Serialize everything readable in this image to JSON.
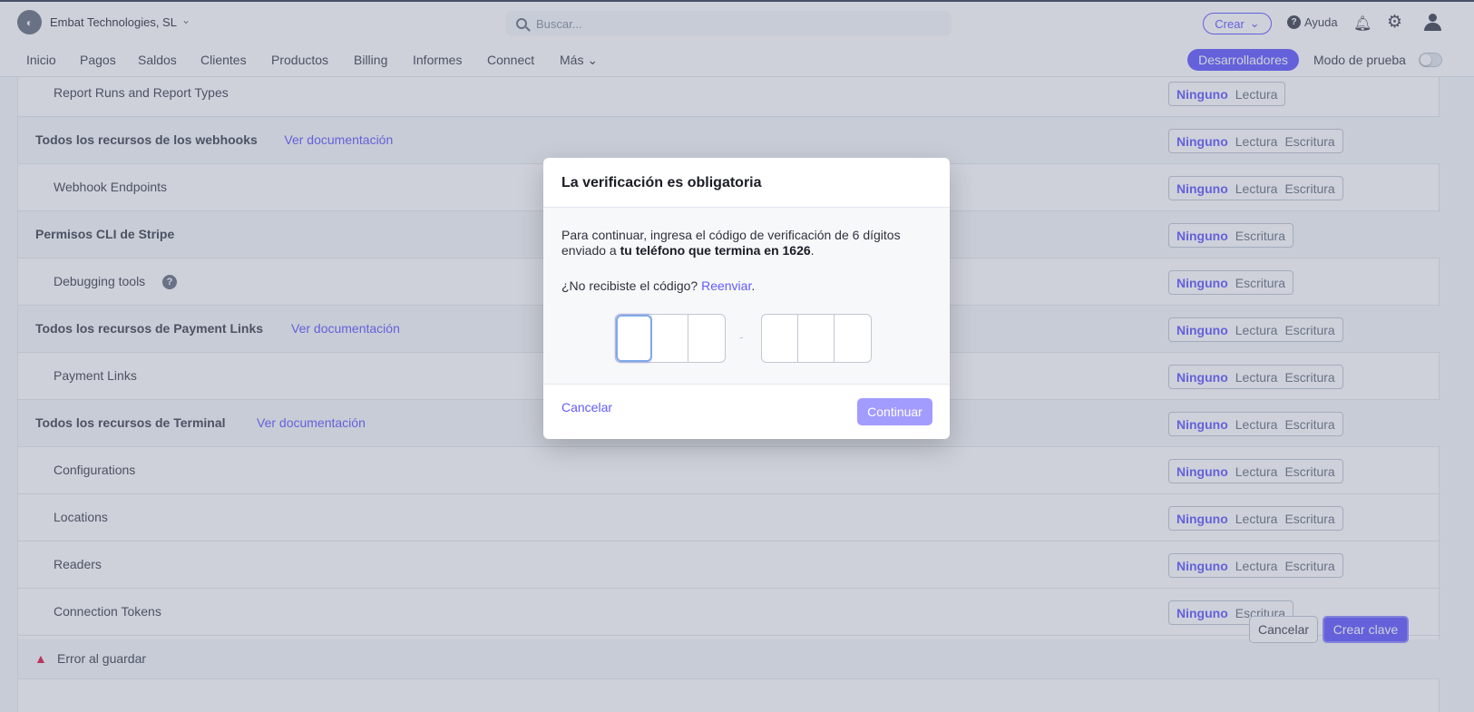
{
  "header": {
    "account_name": "Embat Technologies, SL",
    "search_placeholder": "Buscar...",
    "create_label": "Crear",
    "help_label": "Ayuda"
  },
  "nav": {
    "items": [
      "Inicio",
      "Pagos",
      "Saldos",
      "Clientes",
      "Productos",
      "Billing",
      "Informes",
      "Connect",
      "Más"
    ],
    "developers_label": "Desarrolladores",
    "test_mode_label": "Modo de prueba",
    "test_mode_on": false
  },
  "permissions": [
    {
      "label": "Report Runs and Report Types",
      "kind": "sub",
      "options": [
        "Ninguno",
        "Lectura"
      ],
      "selected": "Ninguno"
    },
    {
      "label": "Todos los recursos de los webhooks",
      "kind": "group",
      "doc_link": "Ver documentación",
      "options": [
        "Ninguno",
        "Lectura",
        "Escritura"
      ],
      "selected": "Ninguno"
    },
    {
      "label": "Webhook Endpoints",
      "kind": "sub",
      "options": [
        "Ninguno",
        "Lectura",
        "Escritura"
      ],
      "selected": "Ninguno"
    },
    {
      "label": "Permisos CLI de Stripe",
      "kind": "group",
      "options": [
        "Ninguno",
        "Escritura"
      ],
      "selected": "Ninguno"
    },
    {
      "label": "Debugging tools",
      "kind": "sub",
      "info": true,
      "options": [
        "Ninguno",
        "Escritura"
      ],
      "selected": "Ninguno"
    },
    {
      "label": "Todos los recursos de Payment Links",
      "kind": "group",
      "doc_link": "Ver documentación",
      "options": [
        "Ninguno",
        "Lectura",
        "Escritura"
      ],
      "selected": "Ninguno"
    },
    {
      "label": "Payment Links",
      "kind": "sub",
      "options": [
        "Ninguno",
        "Lectura",
        "Escritura"
      ],
      "selected": "Ninguno"
    },
    {
      "label": "Todos los recursos de Terminal",
      "kind": "group",
      "doc_link": "Ver documentación",
      "options": [
        "Ninguno",
        "Lectura",
        "Escritura"
      ],
      "selected": "Ninguno"
    },
    {
      "label": "Configurations",
      "kind": "sub",
      "options": [
        "Ninguno",
        "Lectura",
        "Escritura"
      ],
      "selected": "Ninguno"
    },
    {
      "label": "Locations",
      "kind": "sub",
      "options": [
        "Ninguno",
        "Lectura",
        "Escritura"
      ],
      "selected": "Ninguno"
    },
    {
      "label": "Readers",
      "kind": "sub",
      "options": [
        "Ninguno",
        "Lectura",
        "Escritura"
      ],
      "selected": "Ninguno"
    },
    {
      "label": "Connection Tokens",
      "kind": "sub",
      "options": [
        "Ninguno",
        "Escritura"
      ],
      "selected": "Ninguno"
    }
  ],
  "error": {
    "text": "Error al guardar"
  },
  "footer": {
    "cancel_label": "Cancelar",
    "create_label": "Crear clave"
  },
  "modal": {
    "title": "La verificación es obligatoria",
    "text_prefix": "Para continuar, ingresa el código de verificación de 6 dígitos enviado a ",
    "text_bold": "tu teléfono que termina en 1626",
    "text_suffix": ".",
    "resend_prompt": "¿No recibiste el código?",
    "resend_link": "Reenviar",
    "resend_suffix": ".",
    "code_values": [
      "",
      "",
      "",
      "",
      "",
      ""
    ],
    "code_separator": "-",
    "cancel_label": "Cancelar",
    "continue_label": "Continuar"
  },
  "colors": {
    "accent": "#635bff",
    "danger": "#df1b41",
    "overlay": "#68708c"
  }
}
